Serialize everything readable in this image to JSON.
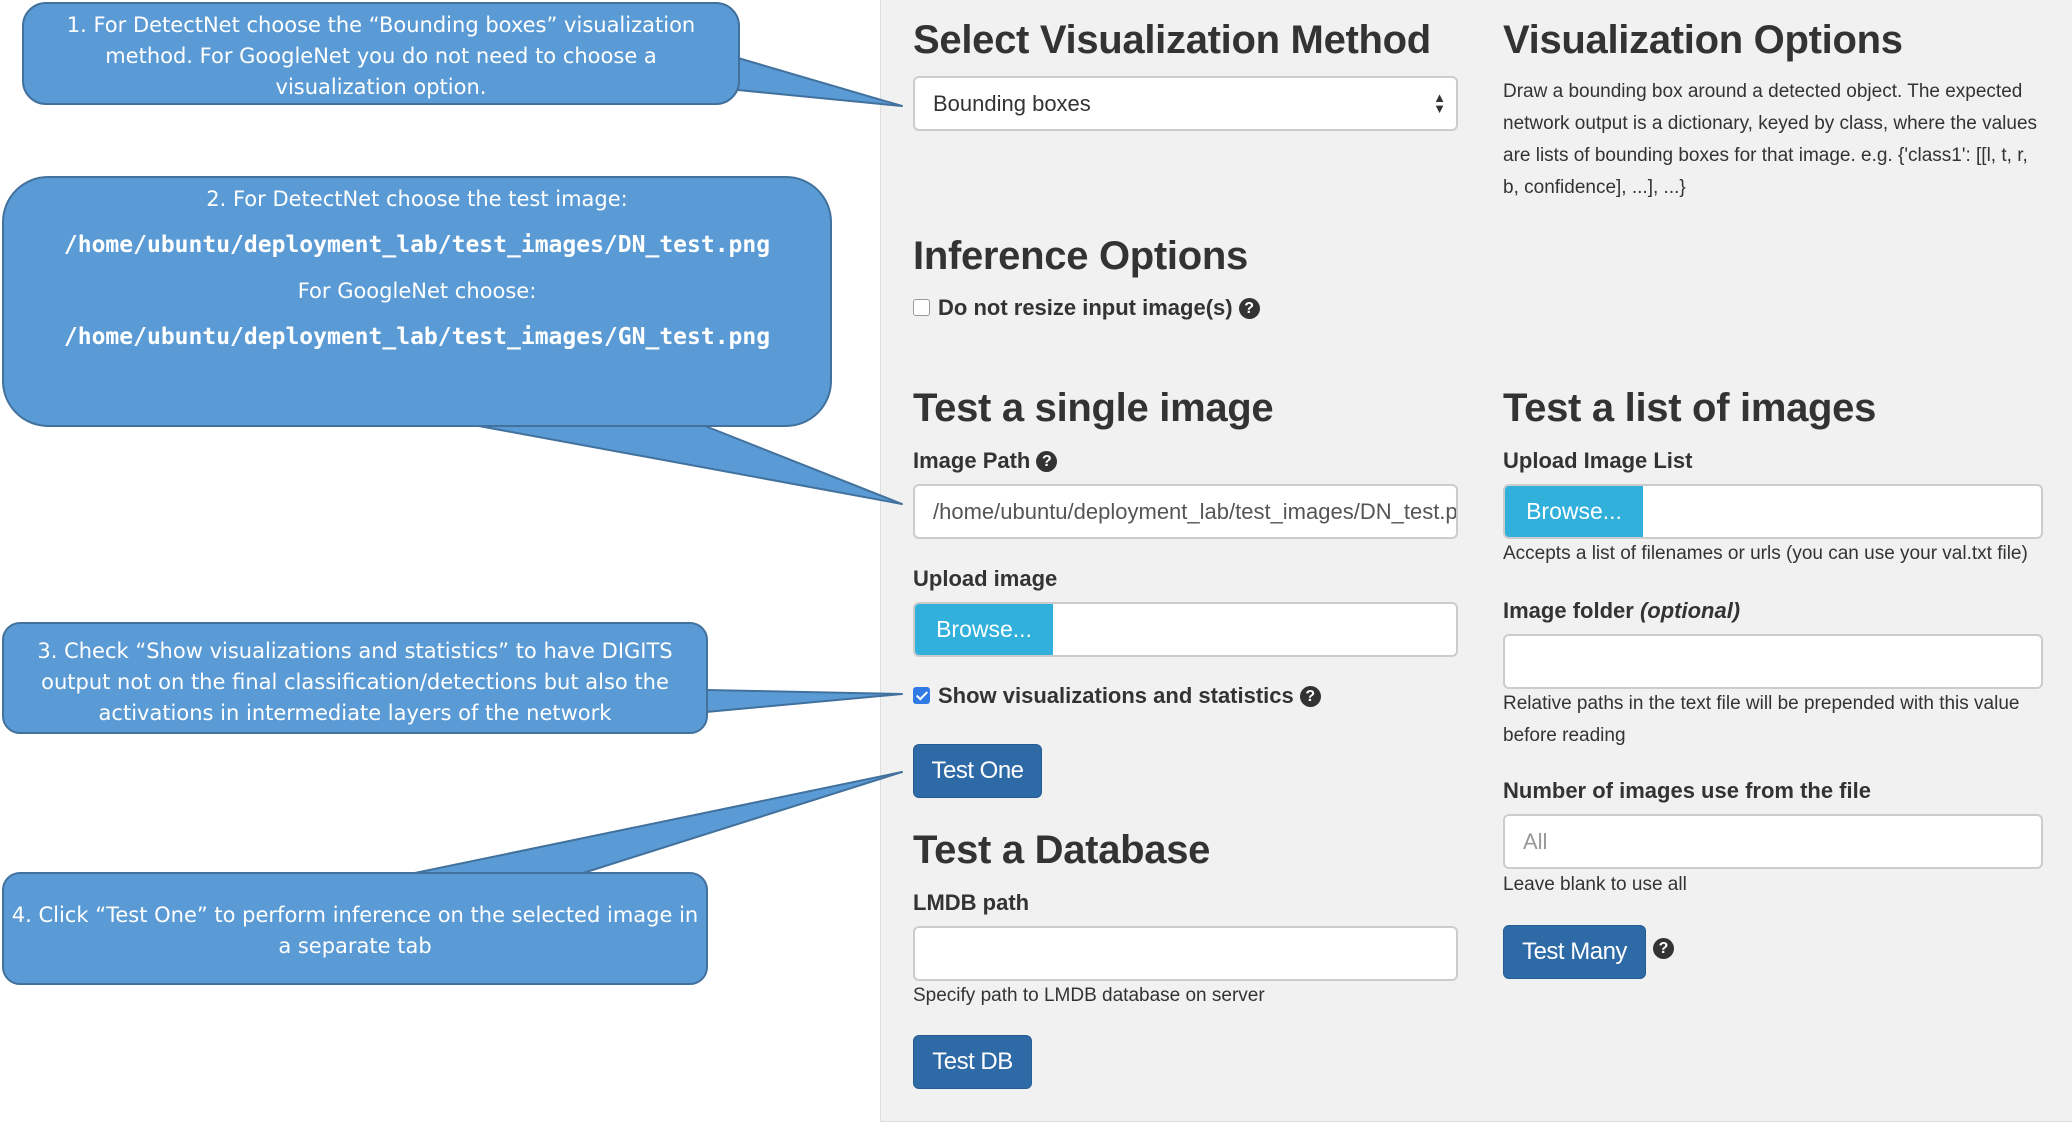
{
  "callouts": [
    {
      "lines": [
        "1. For DetectNet choose the “Bounding boxes” visualization",
        "method.  For GoogleNet  you do not need to choose a",
        "visualization option."
      ]
    },
    {
      "intro": "2. For DetectNet choose the test image:",
      "path1": "/home/ubuntu/deployment_lab/test_images/DN_test.png",
      "mid": "For GoogleNet choose:",
      "path2": "/home/ubuntu/deployment_lab/test_images/GN_test.png"
    },
    {
      "lines": [
        "3. Check “Show visualizations and statistics” to have DIGITS",
        "output not on the final classification/detections but also the",
        "activations in intermediate layers of the network"
      ]
    },
    {
      "lines": [
        "4. Click “Test One” to perform inference on the selected image in",
        "a separate tab"
      ]
    }
  ],
  "visualization": {
    "heading": "Select Visualization Method",
    "selected": "Bounding boxes",
    "options_heading": "Visualization Options",
    "options_text": "Draw a bounding box around a detected object. The expected network output is a dictionary, keyed by class, where the values are lists of bounding boxes for that image. e.g. {'class1': [[l, t, r, b, confidence], ...], ...}"
  },
  "inference": {
    "heading": "Inference Options",
    "no_resize_label": "Do not resize input image(s)",
    "no_resize_checked": false
  },
  "single": {
    "heading": "Test a single image",
    "image_path_label": "Image Path",
    "image_path_value": "/home/ubuntu/deployment_lab/test_images/DN_test.png",
    "upload_label": "Upload image",
    "browse_label": "Browse...",
    "show_vis_label": "Show visualizations and statistics",
    "show_vis_checked": true,
    "test_one_label": "Test One"
  },
  "database": {
    "heading": "Test a Database",
    "lmdb_label": "LMDB path",
    "lmdb_value": "",
    "lmdb_help": "Specify path to LMDB database on server",
    "test_db_label": "Test DB"
  },
  "list": {
    "heading": "Test a list of images",
    "upload_label": "Upload Image List",
    "browse_label": "Browse...",
    "upload_help": "Accepts a list of filenames or urls (you can use your val.txt file)",
    "folder_label": "Image folder",
    "folder_optional": "(optional)",
    "folder_value": "",
    "folder_help": "Relative paths in the text file will be prepended with this value before reading",
    "num_label": "Number of images use from the file",
    "num_placeholder": "All",
    "num_help": "Leave blank to use all",
    "test_many_label": "Test Many"
  },
  "icons": {
    "help": "question-circle-icon",
    "select": "up-down-arrows-icon"
  },
  "colors": {
    "callout_fill": "#5b9bd5",
    "callout_border": "#41719c",
    "primary": "#2e6aa6",
    "info": "#31b0dc",
    "checkbox": "#2f7ae5"
  }
}
